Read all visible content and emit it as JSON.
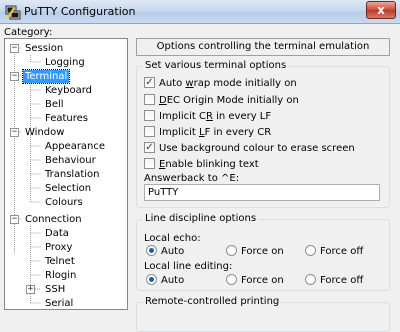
{
  "window": {
    "title": "PuTTY Configuration",
    "close_glyph": "x"
  },
  "category_label": "Category:",
  "tree": [
    {
      "label": "Session"
    },
    {
      "label": "Logging"
    },
    {
      "label": "Terminal"
    },
    {
      "label": "Keyboard"
    },
    {
      "label": "Bell"
    },
    {
      "label": "Features"
    },
    {
      "label": "Window"
    },
    {
      "label": "Appearance"
    },
    {
      "label": "Behaviour"
    },
    {
      "label": "Translation"
    },
    {
      "label": "Selection"
    },
    {
      "label": "Colours"
    },
    {
      "label": "Connection"
    },
    {
      "label": "Data"
    },
    {
      "label": "Proxy"
    },
    {
      "label": "Telnet"
    },
    {
      "label": "Rlogin"
    },
    {
      "label": "SSH"
    },
    {
      "label": "Serial"
    }
  ],
  "panel": {
    "header": "Options controlling the terminal emulation",
    "terminal_options": {
      "title": "Set various terminal options",
      "options": [
        {
          "pre": "Auto ",
          "key": "w",
          "post": "rap mode initially on",
          "checked": true
        },
        {
          "pre": "",
          "key": "D",
          "post": "EC Origin Mode initially on",
          "checked": false
        },
        {
          "pre": "Implicit C",
          "key": "R",
          "post": " in every LF",
          "checked": false
        },
        {
          "pre": "Implicit ",
          "key": "L",
          "post": "F in every CR",
          "checked": false
        },
        {
          "pre": "Use background colour to erase screen",
          "key": "",
          "post": "",
          "checked": true
        },
        {
          "pre": "",
          "key": "E",
          "post": "nable blinking text",
          "checked": false
        }
      ],
      "answerback_label": "Answerback to ^E:",
      "answerback_value": "PuTTY"
    },
    "line_discipline": {
      "title": "Line discipline options",
      "local_echo_label": "Local echo:",
      "local_edit_label": "Local line editing:",
      "radio_labels": [
        "Auto",
        "Force on",
        "Force off"
      ],
      "local_echo_selected": "Auto",
      "local_edit_selected": "Auto"
    },
    "printing": {
      "title": "Remote-controlled printing"
    }
  }
}
